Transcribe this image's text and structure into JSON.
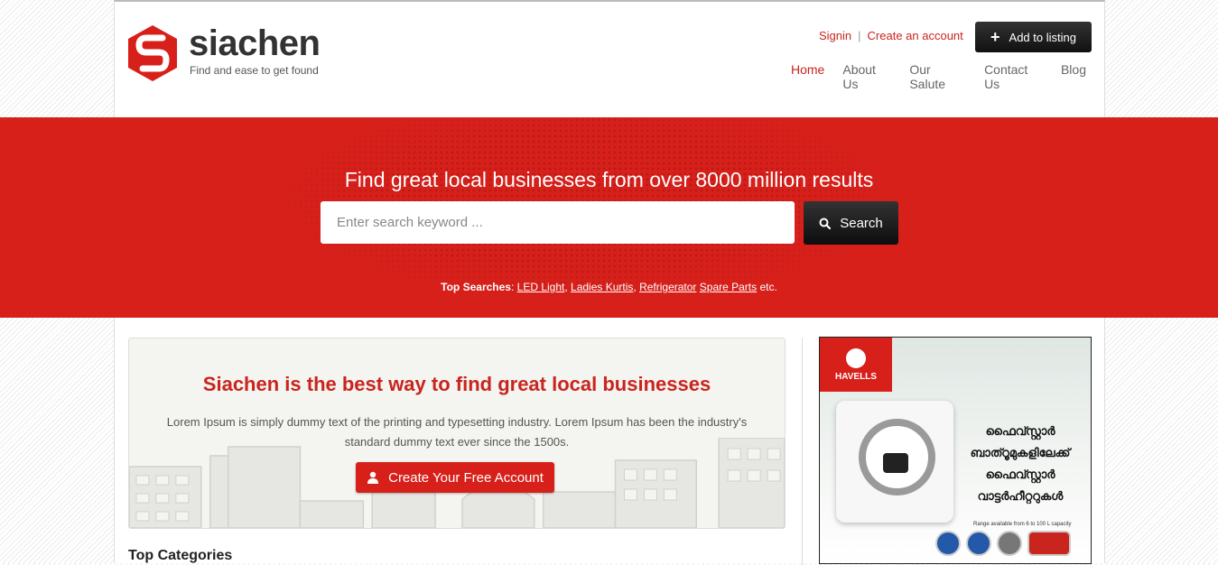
{
  "brand": {
    "name": "siachen",
    "tagline": "Find and ease to get found"
  },
  "toplinks": {
    "signin": "Signin",
    "separator": "|",
    "create_account": "Create an account",
    "add_listing": "Add to listing"
  },
  "nav": [
    "Home",
    "About Us",
    "Our Salute",
    "Contact Us",
    "Blog"
  ],
  "hero": {
    "title": "Find great local businesses from over 8000 million results",
    "search_placeholder": "Enter search keyword ...",
    "search_button": "Search",
    "top_searches_label": "Top Searches",
    "top_searches": [
      "LED Light",
      "Ladies Kurtis",
      "Refrigerator",
      "Spare Parts"
    ],
    "top_searches_suffix": "etc."
  },
  "promo": {
    "title": "Siachen is the best way to find great local businesses",
    "text": "Lorem Ipsum is simply dummy text of the printing and typesetting industry. Lorem Ipsum has been the industry's standard dummy text ever since the 1500s.",
    "button": "Create Your Free Account"
  },
  "section": {
    "top_categories": "Top Categories"
  },
  "ad": {
    "brand": "HAVELLS",
    "line1": "ഫൈവ്സ്റ്റാർ",
    "line2": "ബാത്റൂമുകളിലേക്ക്",
    "line3": "ഫൈവ്സ്റ്റാർ",
    "line4": "വാട്ടർഹീറ്ററുകൾ",
    "small": "Range available from 6 to 100 L capacity"
  },
  "colors": {
    "accent": "#d8201b",
    "dark": "#111111"
  }
}
